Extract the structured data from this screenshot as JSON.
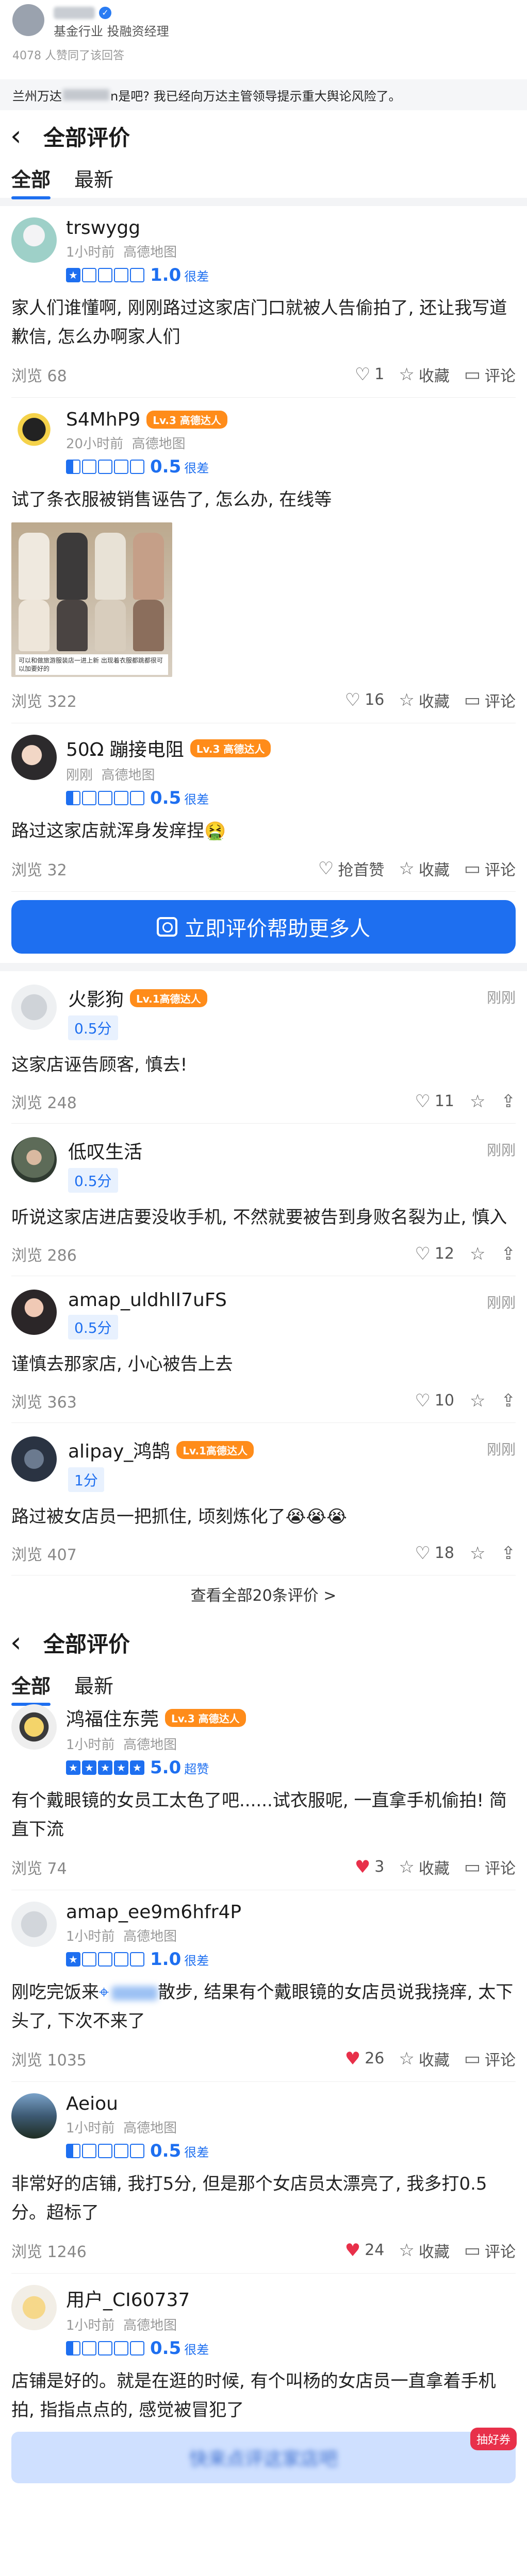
{
  "post": {
    "author_title": "基金行业 投融资经理",
    "agree": "4078 人赞同了该回答",
    "headline_pre": "兰州万达",
    "headline_post": "n是吧? 我已经向万达主管领导提示重大舆论风险了。"
  },
  "section1": {
    "title": "全部评价",
    "tabs": [
      "全部",
      "最新"
    ]
  },
  "reviews1": [
    {
      "name": "trswygg",
      "time": "1小时前",
      "source": "高德地图",
      "score": "1.0",
      "level": "很差",
      "text": "家人们谁懂啊, 刚刚路过这家店门口就被人告偷拍了, 还让我写道歉信, 怎么办啊家人们",
      "views": "浏览 68",
      "likes": "1",
      "collect": "收藏",
      "comment": "评论"
    },
    {
      "name": "S4MhP9",
      "badge": "Lv.3 高德达人",
      "time": "20小时前",
      "source": "高德地图",
      "score": "0.5",
      "level": "很差",
      "text": "试了条衣服被销售诬告了, 怎么办, 在线等",
      "photo_caption": "可以和做旅游服装店一进上新 出现着衣服都跳都很可以加要好的",
      "views": "浏览 322",
      "likes": "16",
      "collect": "收藏",
      "comment": "评论"
    },
    {
      "name": "50Ω 蹦接电阻",
      "badge": "Lv.3 高德达人",
      "time": "刚刚",
      "source": "高德地图",
      "score": "0.5",
      "level": "很差",
      "text": "路过这家店就浑身发痒捏🤮",
      "views": "浏览 32",
      "likes": "抢首赞",
      "collect": "收藏",
      "comment": "评论"
    }
  ],
  "cta": {
    "label": "立即评价帮助更多人"
  },
  "short_reviews": [
    {
      "name": "火影狗",
      "badge": "Lv.1高德达人",
      "score": "0.5分",
      "time": "刚刚",
      "text": "这家店诬告顾客, 慎去!",
      "views": "浏览 248",
      "likes": "11"
    },
    {
      "name": "低叹生活",
      "badge": "",
      "score": "0.5分",
      "time": "刚刚",
      "text": "听说这家店进店要没收手机, 不然就要被告到身败名裂为止, 慎入",
      "views": "浏览 286",
      "likes": "12"
    },
    {
      "name": "amap_uldhlI7uFS",
      "badge": "",
      "score": "0.5分",
      "time": "刚刚",
      "text": "谨慎去那家店, 小心被告上去",
      "views": "浏览 363",
      "likes": "10"
    },
    {
      "name": "alipay_鸿鹄",
      "badge": "Lv.1高德达人",
      "score": "1分",
      "time": "刚刚",
      "text": "路过被女店员一把抓住, 顷刻炼化了😭😭😭",
      "views": "浏览 407",
      "likes": "18"
    }
  ],
  "more": "查看全部20条评价 >",
  "section2": {
    "title": "全部评价",
    "tabs": [
      "全部",
      "最新"
    ]
  },
  "reviews2": [
    {
      "name": "鸿福住东莞",
      "badge": "Lv.3 高德达人",
      "time": "1小时前",
      "source": "高德地图",
      "score": "5.0",
      "level": "超赞",
      "text": "有个戴眼镜的女员工太色了吧......试衣服呢, 一直拿手机偷拍! 简直下流",
      "views": "浏览 74",
      "likes": "3",
      "collect": "收藏",
      "comment": "评论"
    },
    {
      "name": "amap_ee9m6hfr4P",
      "time": "1小时前",
      "source": "高德地图",
      "score": "1.0",
      "level": "很差",
      "text_pre": "刚吃完饭来",
      "text_post": "散步, 结果有个戴眼镜的女店员说我挠痒, 太下头了, 下次不来了",
      "views": "浏览 1035",
      "likes": "26",
      "collect": "收藏",
      "comment": "评论"
    },
    {
      "name": "Aeiou",
      "time": "1小时前",
      "source": "高德地图",
      "score": "0.5",
      "level": "很差",
      "text": "非常好的店铺, 我打5分, 但是那个女店员太漂亮了, 我多打0.5分。超标了",
      "views": "浏览 1246",
      "likes": "24",
      "collect": "收藏",
      "comment": "评论"
    },
    {
      "name": "用户_CI60737",
      "time": "1小时前",
      "source": "高德地图",
      "score": "0.5",
      "level": "很差",
      "text": "店铺是好的。就是在逛的时候, 有个叫杨的女店员一直拿着手机拍, 指指点点的, 感觉被冒犯了",
      "float": "抽好券"
    }
  ],
  "bottom_bar": "快来点评这家店吧"
}
